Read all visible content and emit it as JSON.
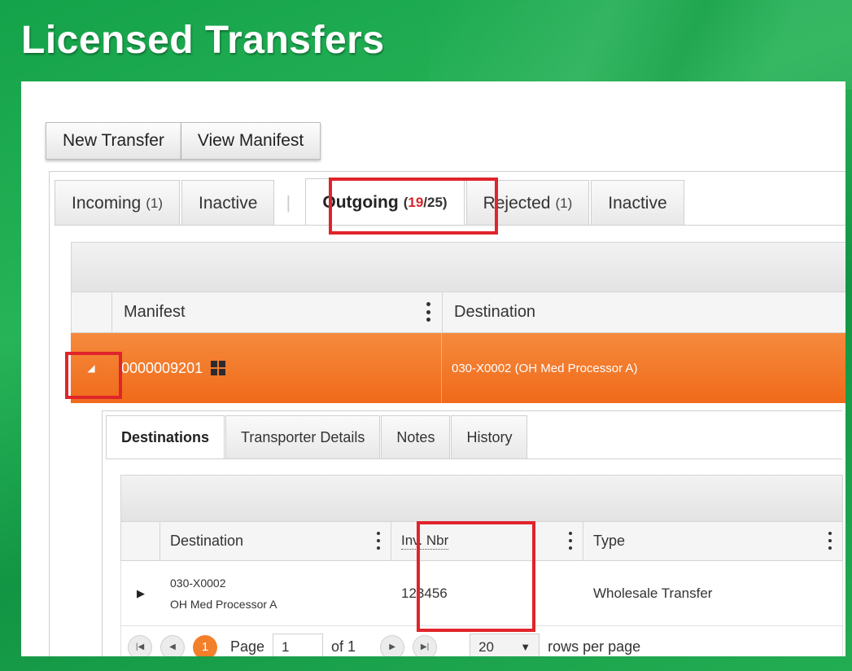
{
  "page_title": "Licensed Transfers",
  "toolbar": {
    "new_transfer": "New Transfer",
    "view_manifest": "View Manifest"
  },
  "tabs": {
    "incoming": {
      "label": "Incoming",
      "count": "(1)"
    },
    "inactive_1": {
      "label": "Inactive"
    },
    "separator": "|",
    "outgoing": {
      "label": "Outgoing",
      "count_open": "(",
      "count_active": "19",
      "count_rest": "/25)"
    },
    "rejected": {
      "label": "Rejected",
      "count": "(1)"
    },
    "inactive_2": {
      "label": "Inactive"
    }
  },
  "grid": {
    "columns": {
      "manifest": "Manifest",
      "destination": "Destination"
    },
    "row": {
      "expander_icon": "triangle-icon",
      "manifest": "0000009201",
      "destination": "030-X0002 (OH Med Processor A)"
    }
  },
  "detail_tabs": [
    "Destinations",
    "Transporter Details",
    "Notes",
    "History"
  ],
  "sub_grid": {
    "columns": {
      "destination": "Destination",
      "inv_nbr": "Inv. Nbr",
      "type": "Type"
    },
    "row": {
      "destination_line1": "030-X0002",
      "destination_line2": "OH Med Processor A",
      "inv_nbr": "123456",
      "type": "Wholesale Transfer"
    }
  },
  "pager": {
    "current_page": "1",
    "page_label": "Page",
    "page_input": "1",
    "of_label": "of 1",
    "rows_per_page": "20",
    "rows_label": "rows per page"
  },
  "colors": {
    "accent_orange": "#f06a1a",
    "highlight_red": "#e0242b",
    "brand_green": "#1fa84f"
  }
}
